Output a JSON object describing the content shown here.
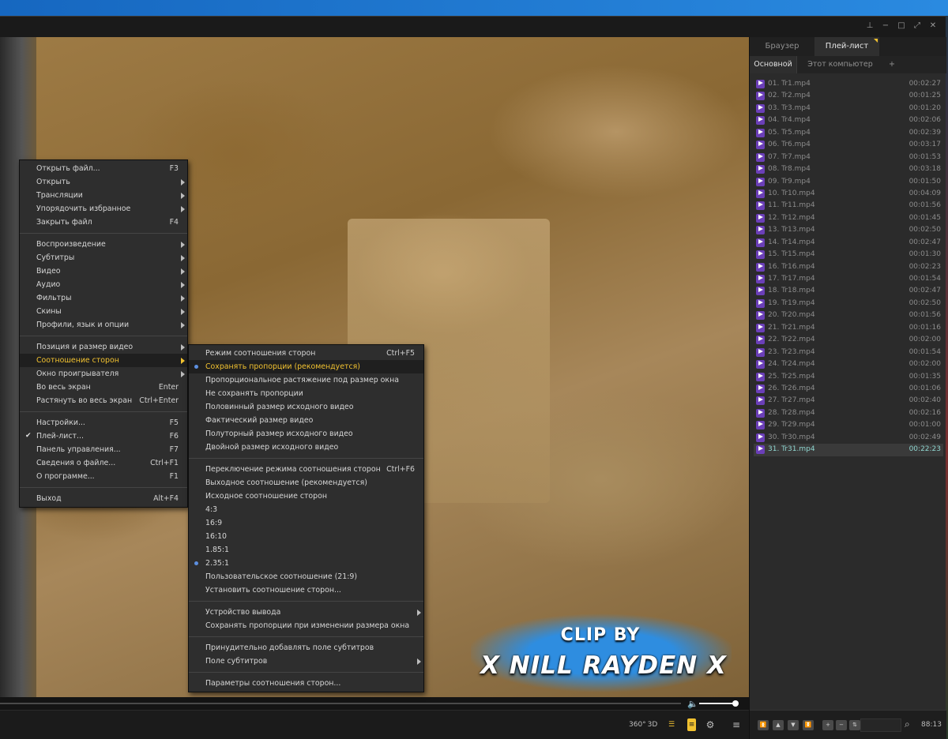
{
  "window": {
    "buttons": [
      "pin-icon",
      "minimize-icon",
      "maximize-icon",
      "fullscreen-icon",
      "close-icon"
    ]
  },
  "video": {
    "overlay_line1": "CLIP BY",
    "overlay_line2": "X NILL RAYDEN X"
  },
  "controls": {
    "btn_360": "360°",
    "btn_3d": "3D",
    "volume_level": 0.92
  },
  "panel": {
    "tabs": [
      {
        "label": "Браузер",
        "active": false
      },
      {
        "label": "Плей-лист",
        "active": true
      }
    ],
    "subtabs": [
      {
        "label": "Основной",
        "active": true
      },
      {
        "label": "Этот компьютер",
        "active": false
      },
      {
        "label": "+",
        "active": false
      }
    ],
    "items": [
      {
        "name": "01. Tr1.mp4",
        "dur": "00:02:27"
      },
      {
        "name": "02. Tr2.mp4",
        "dur": "00:01:25"
      },
      {
        "name": "03. Tr3.mp4",
        "dur": "00:01:20"
      },
      {
        "name": "04. Tr4.mp4",
        "dur": "00:02:06"
      },
      {
        "name": "05. Tr5.mp4",
        "dur": "00:02:39"
      },
      {
        "name": "06. Tr6.mp4",
        "dur": "00:03:17"
      },
      {
        "name": "07. Tr7.mp4",
        "dur": "00:01:53"
      },
      {
        "name": "08. Tr8.mp4",
        "dur": "00:03:18"
      },
      {
        "name": "09. Tr9.mp4",
        "dur": "00:01:50"
      },
      {
        "name": "10. Tr10.mp4",
        "dur": "00:04:09"
      },
      {
        "name": "11. Tr11.mp4",
        "dur": "00:01:56"
      },
      {
        "name": "12. Tr12.mp4",
        "dur": "00:01:45"
      },
      {
        "name": "13. Tr13.mp4",
        "dur": "00:02:50"
      },
      {
        "name": "14. Tr14.mp4",
        "dur": "00:02:47"
      },
      {
        "name": "15. Tr15.mp4",
        "dur": "00:01:30"
      },
      {
        "name": "16. Tr16.mp4",
        "dur": "00:02:23"
      },
      {
        "name": "17. Tr17.mp4",
        "dur": "00:01:54"
      },
      {
        "name": "18. Tr18.mp4",
        "dur": "00:02:47"
      },
      {
        "name": "19. Tr19.mp4",
        "dur": "00:02:50"
      },
      {
        "name": "20. Tr20.mp4",
        "dur": "00:01:56"
      },
      {
        "name": "21. Tr21.mp4",
        "dur": "00:01:16"
      },
      {
        "name": "22. Tr22.mp4",
        "dur": "00:02:00"
      },
      {
        "name": "23. Tr23.mp4",
        "dur": "00:01:54"
      },
      {
        "name": "24. Tr24.mp4",
        "dur": "00:02:00"
      },
      {
        "name": "25. Tr25.mp4",
        "dur": "00:01:35"
      },
      {
        "name": "26. Tr26.mp4",
        "dur": "00:01:06"
      },
      {
        "name": "27. Tr27.mp4",
        "dur": "00:02:40"
      },
      {
        "name": "28. Tr28.mp4",
        "dur": "00:02:16"
      },
      {
        "name": "29. Tr29.mp4",
        "dur": "00:01:00"
      },
      {
        "name": "30. Tr30.mp4",
        "dur": "00:02:49"
      },
      {
        "name": "31. Tr31.mp4",
        "dur": "00:22:23",
        "current": true
      }
    ],
    "total": "88:13"
  },
  "main_menu": [
    {
      "label": "Открыть файл...",
      "shortcut": "F3"
    },
    {
      "label": "Открыть",
      "submenu": true
    },
    {
      "label": "Трансляции",
      "submenu": true
    },
    {
      "label": "Упорядочить избранное",
      "submenu": true
    },
    {
      "label": "Закрыть файл",
      "shortcut": "F4"
    },
    {
      "sep": true
    },
    {
      "label": "Воспроизведение",
      "submenu": true
    },
    {
      "label": "Субтитры",
      "submenu": true
    },
    {
      "label": "Видео",
      "submenu": true
    },
    {
      "label": "Аудио",
      "submenu": true
    },
    {
      "label": "Фильтры",
      "submenu": true
    },
    {
      "label": "Скины",
      "submenu": true
    },
    {
      "label": "Профили, язык и опции",
      "submenu": true
    },
    {
      "sep": true
    },
    {
      "label": "Позиция и размер видео",
      "submenu": true
    },
    {
      "label": "Соотношение сторон",
      "submenu": true,
      "highlight": true
    },
    {
      "label": "Окно проигрывателя",
      "submenu": true
    },
    {
      "label": "Во весь экран",
      "shortcut": "Enter"
    },
    {
      "label": "Растянуть во весь экран",
      "shortcut": "Ctrl+Enter"
    },
    {
      "sep": true
    },
    {
      "label": "Настройки...",
      "shortcut": "F5"
    },
    {
      "label": "Плей-лист...",
      "shortcut": "F6",
      "checked": true
    },
    {
      "label": "Панель управления...",
      "shortcut": "F7"
    },
    {
      "label": "Сведения о файле...",
      "shortcut": "Ctrl+F1"
    },
    {
      "label": "О программе...",
      "shortcut": "F1"
    },
    {
      "sep": true
    },
    {
      "label": "Выход",
      "shortcut": "Alt+F4"
    }
  ],
  "aspect_menu": [
    {
      "label": "Режим соотношения сторон",
      "shortcut": "Ctrl+F5"
    },
    {
      "label": "Сохранять пропорции (рекомендуется)",
      "radio": true,
      "highlight": true
    },
    {
      "label": "Пропорциональное растяжение под размер окна"
    },
    {
      "label": "Не сохранять пропорции"
    },
    {
      "label": "Половинный размер исходного видео"
    },
    {
      "label": "Фактический размер видео"
    },
    {
      "label": "Полуторный размер исходного видео"
    },
    {
      "label": "Двойной размер исходного видео"
    },
    {
      "sep": true
    },
    {
      "label": "Переключение режима соотношения сторон",
      "shortcut": "Ctrl+F6"
    },
    {
      "label": "Выходное соотношение (рекомендуется)"
    },
    {
      "label": "Исходное соотношение сторон"
    },
    {
      "label": "4:3"
    },
    {
      "label": "16:9"
    },
    {
      "label": "16:10"
    },
    {
      "label": "1.85:1"
    },
    {
      "label": "2.35:1",
      "radio": true
    },
    {
      "label": "Пользовательское соотношение (21:9)"
    },
    {
      "label": "Установить соотношение сторон..."
    },
    {
      "sep": true
    },
    {
      "label": "Устройство вывода",
      "submenu": true
    },
    {
      "label": "Сохранять пропорции при изменении размера окна"
    },
    {
      "sep": true
    },
    {
      "label": "Принудительно добавлять поле субтитров"
    },
    {
      "label": "Поле субтитров",
      "submenu": true
    },
    {
      "sep": true
    },
    {
      "label": "Параметры соотношения сторон..."
    }
  ]
}
